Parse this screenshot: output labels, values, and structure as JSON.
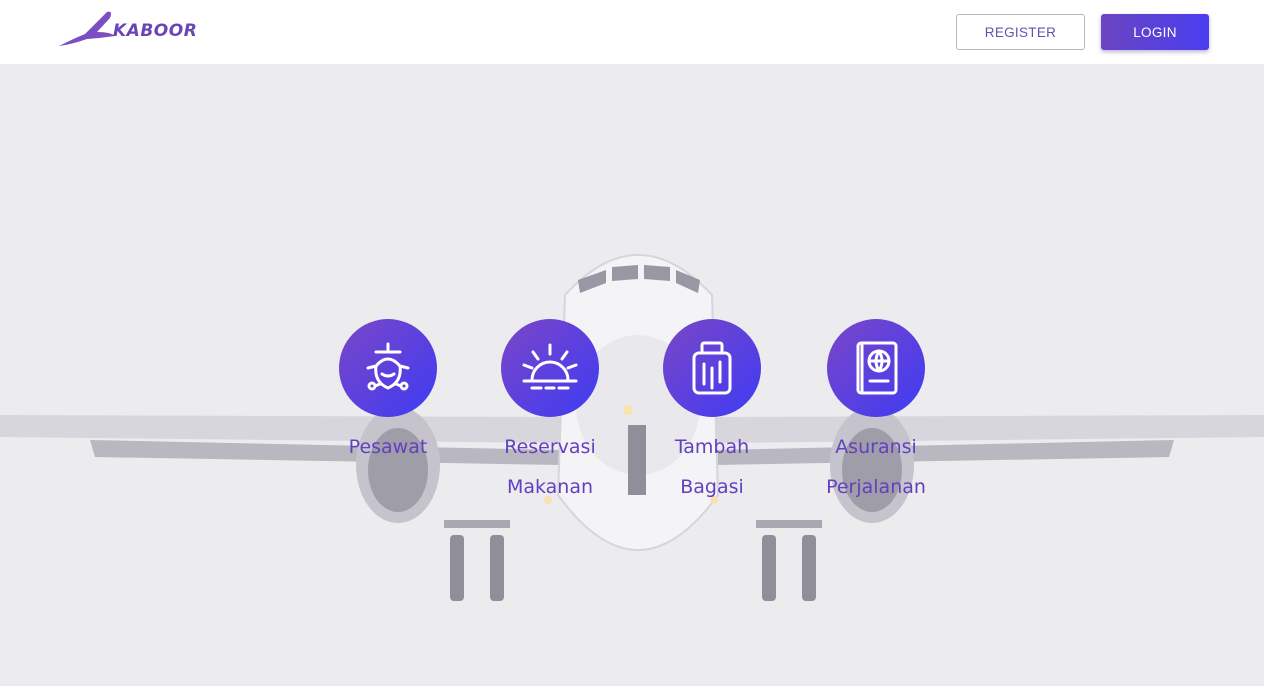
{
  "header": {
    "logo_text": "KABOOR",
    "register_label": "REGISTER",
    "login_label": "LOGIN"
  },
  "services": [
    {
      "icon": "plane-icon",
      "line1": "Pesawat",
      "line2": ""
    },
    {
      "icon": "sunrise-icon",
      "line1": "Reservasi",
      "line2": "Makanan"
    },
    {
      "icon": "luggage-icon",
      "line1": "Tambah",
      "line2": "Bagasi"
    },
    {
      "icon": "passport-icon",
      "line1": "Asuransi",
      "line2": "Perjalanan"
    }
  ],
  "colors": {
    "brand": "#6a45b5",
    "accent_start": "#7a46c6",
    "accent_end": "#3d3cf2",
    "label": "#6240c0"
  }
}
